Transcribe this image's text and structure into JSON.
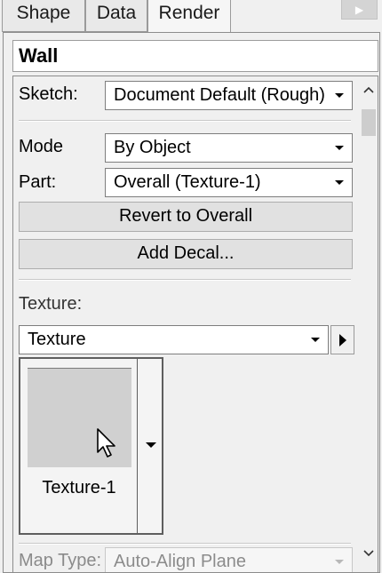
{
  "tabs": [
    {
      "label": "Shape"
    },
    {
      "label": "Data"
    },
    {
      "label": "Render"
    }
  ],
  "header": {
    "title": "Wall"
  },
  "sketch": {
    "label": "Sketch:",
    "value": "Document Default (Rough)"
  },
  "mode": {
    "label": "Mode",
    "value": "By Object"
  },
  "part": {
    "label": "Part:",
    "value": "Overall (Texture-1)"
  },
  "buttons": {
    "revert": "Revert to Overall",
    "add_decal": "Add Decal..."
  },
  "texture": {
    "section_label": "Texture:",
    "combo_value": "Texture",
    "swatch_name": "Texture-1"
  },
  "map_type": {
    "label": "Map Type:",
    "value": "Auto-Align Plane"
  },
  "icons": {
    "dropdown": "chevron-down-icon",
    "play": "play-icon",
    "cursor": "mouse-pointer-icon",
    "scroll_up": "chevron-up-icon",
    "scroll_down": "chevron-down-icon",
    "tab_scroll": "tab-scroll-right-icon"
  }
}
